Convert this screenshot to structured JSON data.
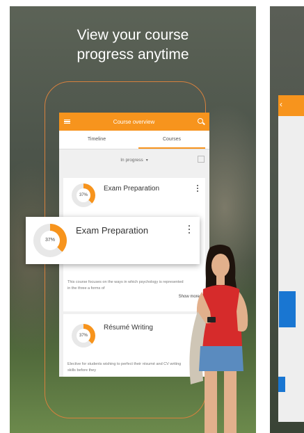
{
  "headline": {
    "line1": "View your course",
    "line2": "progress anytime"
  },
  "app": {
    "title": "Course overview",
    "menu_icon": "hamburger-menu-icon",
    "search_icon": "search-icon",
    "accent_color": "#f7941d",
    "tabs": [
      {
        "label": "Timeline",
        "active": false
      },
      {
        "label": "Courses",
        "active": true
      }
    ],
    "filter": {
      "selected": "In progress",
      "caret": "▾"
    }
  },
  "courses": [
    {
      "title": "Exam Preparation",
      "progress_label": "37%",
      "progress": 0.37,
      "description": "This course focuses on the ways in which psychology is represented in the three a forms of",
      "show_more": "Show more"
    },
    {
      "title": "Résumé Writing",
      "progress_label": "37%",
      "progress": 0.37,
      "description": "Elective for students wishing to perfect their résumé and CV writing skills before they"
    }
  ],
  "overlay_card": {
    "title": "Exam Preparation",
    "progress_label": "37%",
    "progress": 0.37
  }
}
